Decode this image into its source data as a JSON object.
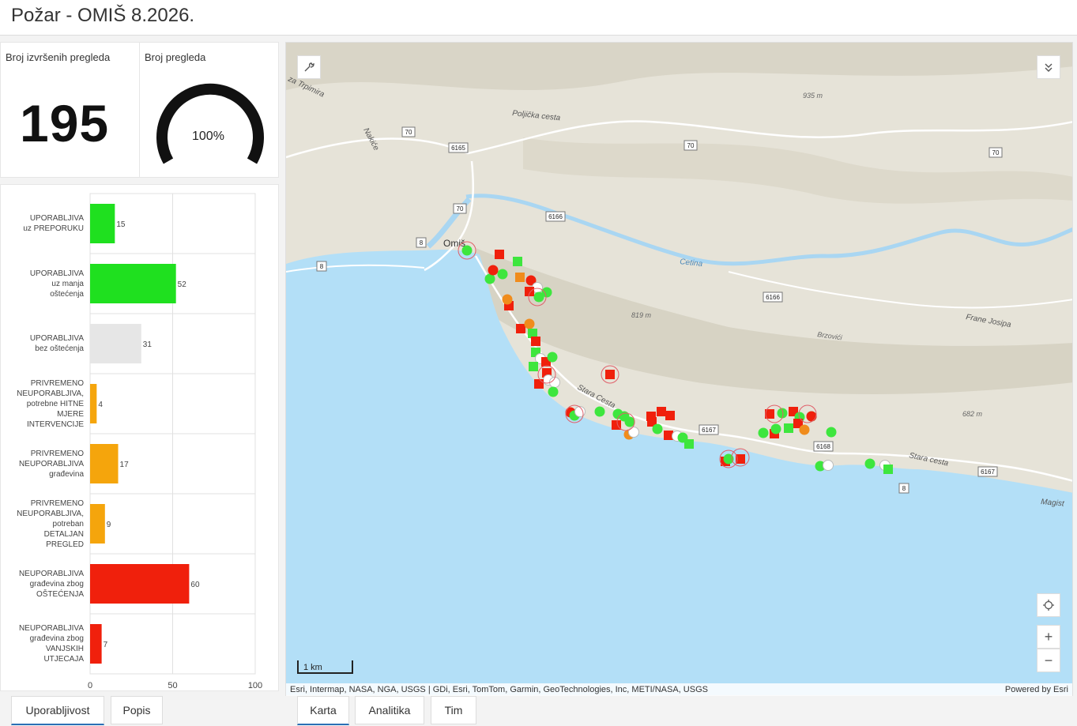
{
  "header": {
    "title": "Požar - OMIŠ 8.2026."
  },
  "kpi": {
    "label": "Broj izvršenih pregleda",
    "value": "195"
  },
  "gauge": {
    "label": "Broj pregleda",
    "value_text": "100%",
    "fraction": 1.0
  },
  "chart_data": {
    "type": "bar",
    "orientation": "horizontal",
    "categories": [
      [
        "UPORABLJIVA",
        "uz PREPORUKU"
      ],
      [
        "UPORABLJIVA",
        "uz manja",
        "oštećenja"
      ],
      [
        "UPORABLJIVA",
        "bez oštećenja"
      ],
      [
        "PRIVREMENO",
        "NEUPORABLJIVA,",
        "potrebne HITNE",
        "MJERE",
        "INTERVENCIJE"
      ],
      [
        "PRIVREMENO",
        "NEUPORABLJIVA",
        "građevina"
      ],
      [
        "PRIVREMENO",
        "NEUPORABLJIVA,",
        "potreban",
        "DETALJAN",
        "PREGLED"
      ],
      [
        "NEUPORABLJIVA",
        "građevina zbog",
        "OŠTEĆENJA"
      ],
      [
        "NEUPORABLJIVA",
        "građevina zbog",
        "VANJSKIH",
        "UTJECAJA"
      ]
    ],
    "values": [
      15,
      52,
      31,
      4,
      17,
      9,
      60,
      7
    ],
    "value_labels": [
      "15",
      "52",
      "31",
      "4",
      "17",
      "9",
      "60",
      "7"
    ],
    "colors": [
      "#1fe01f",
      "#1fe01f",
      "#e6e6e6",
      "#f5a50c",
      "#f5a50c",
      "#f5a50c",
      "#f0200c",
      "#f0200c"
    ],
    "xlim": [
      0,
      100
    ],
    "xticks": [
      "0",
      "50",
      "100"
    ],
    "grid": true
  },
  "left_tabs": [
    {
      "label": "Uporabljivost",
      "active": true
    },
    {
      "label": "Popis",
      "active": false
    }
  ],
  "map_tabs": [
    {
      "label": "Karta",
      "active": true
    },
    {
      "label": "Analitika",
      "active": false
    },
    {
      "label": "Tim",
      "active": false
    }
  ],
  "map": {
    "place_labels": [
      "Omiš",
      "Poljička cesta",
      "Cetina",
      "Stara Cesta",
      "Stara cesta",
      "Brzovići",
      "Frane Josipa",
      "Nakiće",
      "za Trpimira",
      "Magist"
    ],
    "elevation_labels": [
      "935 m",
      "819 m",
      "682 m"
    ],
    "road_shields": [
      "70",
      "70",
      "70",
      "70",
      "6165",
      "6166",
      "6166",
      "6167",
      "6167",
      "6168",
      "8",
      "8",
      "8"
    ],
    "scale_label": "1 km",
    "attribution": "Esri, Intermap, NASA, NGA, USGS | GDi, Esri, TomTom, Garmin, GeoTechnologies, Inc, METI/NASA, USGS",
    "powered_by": "Powered by Esri",
    "icons": {
      "tool": "wrench-icon",
      "collapse": "chevrons-down-icon",
      "locate": "locate-icon",
      "zoom_in": "plus-icon",
      "zoom_out": "minus-icon"
    },
    "zoom_in_label": "+",
    "zoom_out_label": "−",
    "colors": {
      "sea": "#b3dff7",
      "land": "#e8e6de",
      "green": "#3ee63e",
      "red": "#f0200c",
      "orange": "#f08c1c"
    }
  }
}
